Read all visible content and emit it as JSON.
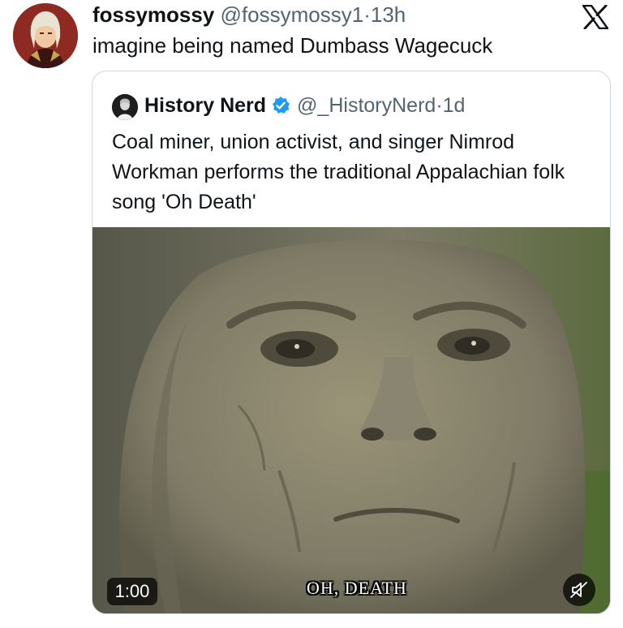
{
  "tweet": {
    "display_name": "fossymossy",
    "handle": "@fossymossy1",
    "separator": "·",
    "time": "13h",
    "text": "imagine being named Dumbass Wagecuck"
  },
  "quoted_tweet": {
    "display_name": "History Nerd",
    "handle": "@_HistoryNerd",
    "separator": "·",
    "time": "1d",
    "text": "Coal miner, union activist, and singer Nimrod Workman performs the traditional Appalachian folk song 'Oh Death'",
    "video": {
      "duration": "1:00",
      "caption": "OH, DEATH"
    }
  },
  "icons": {
    "brand": "x-logo-icon",
    "verified": "verified-badge-icon",
    "mute": "muted-speaker-icon"
  },
  "colors": {
    "text": "#0f1419",
    "muted": "#536471",
    "verified": "#1d9bf0",
    "border": "#cfd9de"
  }
}
